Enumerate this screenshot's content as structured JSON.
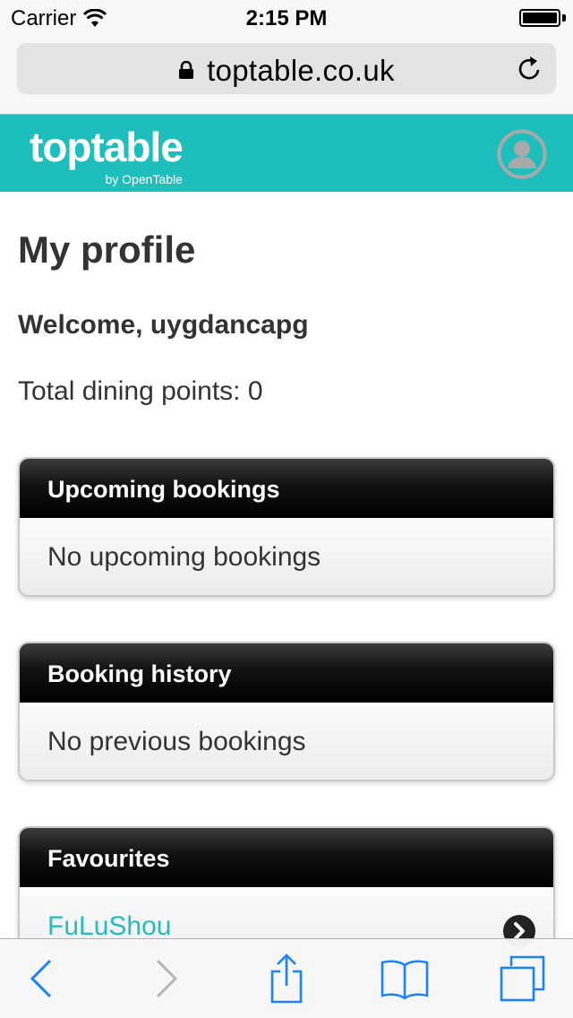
{
  "status_bar": {
    "carrier": "Carrier",
    "time": "2:15 PM"
  },
  "browser": {
    "url": "toptable.co.uk"
  },
  "site_header": {
    "logo": "toptable",
    "logo_sub": "by OpenTable",
    "brand_color": "#1dbebc"
  },
  "profile": {
    "title": "My profile",
    "welcome": "Welcome, uygdancapg",
    "points": "Total dining points: 0"
  },
  "panels": {
    "upcoming": {
      "title": "Upcoming bookings",
      "body": "No upcoming bookings"
    },
    "history": {
      "title": "Booking history",
      "body": "No previous bookings"
    },
    "favourites": {
      "title": "Favourites",
      "items": [
        "FuLuShou"
      ]
    }
  },
  "toolbar": {
    "icons": [
      "back-icon",
      "forward-icon",
      "share-icon",
      "bookmarks-icon",
      "tabs-icon"
    ],
    "accent": "#1a82fb"
  }
}
